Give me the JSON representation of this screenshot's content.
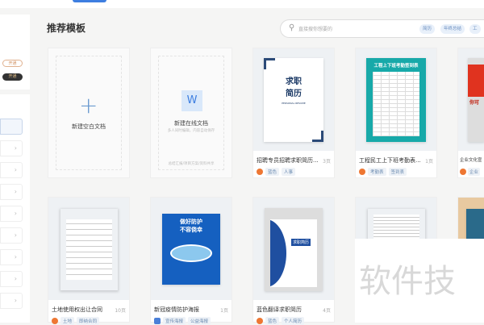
{
  "sidebar": {
    "badge_open_outline": "开通",
    "badge_open_dark": "开通",
    "chevron": "›"
  },
  "main": {
    "title": "推荐模板"
  },
  "search": {
    "placeholder": "直接搜你想要的",
    "tags": [
      "简历",
      "年终总结",
      "工"
    ]
  },
  "blank_card": {
    "label": "新建空白文档"
  },
  "online_card": {
    "label": "新建在线文档",
    "subtitle": "多人同时编辑，内容自动保存",
    "footer": "总结汇报/项目方案/资料共享",
    "icon_letter": "W"
  },
  "templates": [
    {
      "title": "招聘专员招聘求职简历...",
      "pages": "3页",
      "tags": [
        "蓝色",
        "人事"
      ],
      "thumb_text": "求职\n简历",
      "thumb_sub": "PERSONAL RESUME"
    },
    {
      "title": "工程民工上下班考勤表...",
      "pages": "1页",
      "tags": [
        "考勤表",
        "签到表"
      ],
      "thumb_text": "工程上下班考勤签到表"
    },
    {
      "title": "企业文化宣",
      "pages": "",
      "tags": [
        "企业"
      ],
      "thumb_text": "你可"
    },
    {
      "title": "土地使用权出让合同",
      "pages": "10页",
      "tags": [
        "土地",
        "即纳合同"
      ]
    },
    {
      "title": "新冠疫情防护海报",
      "pages": "1页",
      "tags": [
        "宣传海报",
        "公益海报"
      ],
      "thumb_text": "做好防护\n不容侥幸"
    },
    {
      "title": "蓝色翻译求职简历",
      "pages": "4页",
      "tags": [
        "蓝色",
        "个人简历"
      ],
      "thumb_text": "求职简历"
    }
  ],
  "watermark": "软件技"
}
